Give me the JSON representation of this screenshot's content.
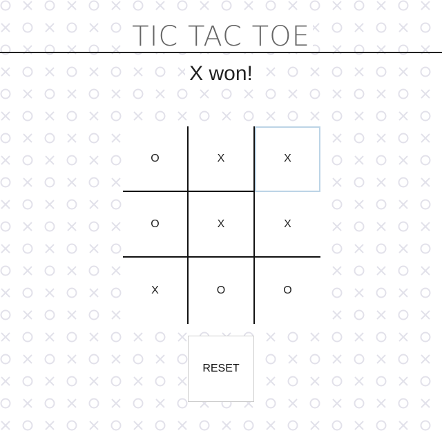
{
  "title": "TIC TAC TOE",
  "status": "X won!",
  "board": [
    "O",
    "X",
    "X",
    "O",
    "X",
    "X",
    "X",
    "O",
    "O"
  ],
  "reset_label": "RESET",
  "colors": {
    "pattern": "#e2e1ea",
    "rule": "#222222",
    "focus": "#bcd4e6"
  }
}
